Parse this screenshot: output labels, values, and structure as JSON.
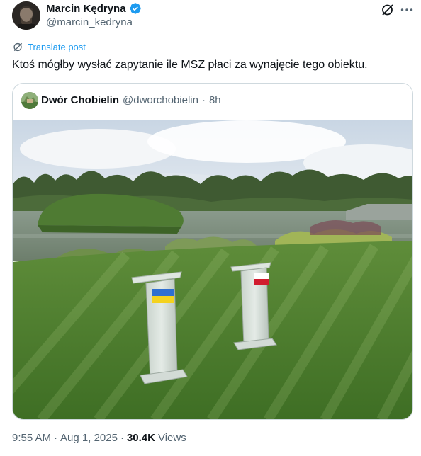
{
  "author": {
    "name": "Marcin Kędryna",
    "handle": "@marcin_kedryna",
    "verified": true,
    "verified_color": "#1d9bf0"
  },
  "icons": {
    "grok": "grok-icon",
    "more": "more-icon",
    "translate": "translate-icon"
  },
  "translate_label": "Translate post",
  "tweet_text": "Ktoś mógłby wysłać zapytanie ile MSZ płaci za wynajęcie tego obiektu.",
  "quote": {
    "name": "Dwór Chobielin",
    "handle": "@dworchobielin",
    "separator": "·",
    "time": "8h"
  },
  "meta": {
    "time": "9:55 AM",
    "separator": "·",
    "date": "Aug 1, 2025",
    "views_count": "30.4K",
    "views_label": "Views"
  },
  "colors": {
    "accent": "#1d9bf0",
    "secondary_text": "#536471",
    "primary_text": "#0f1419",
    "border": "#cfd9de"
  }
}
